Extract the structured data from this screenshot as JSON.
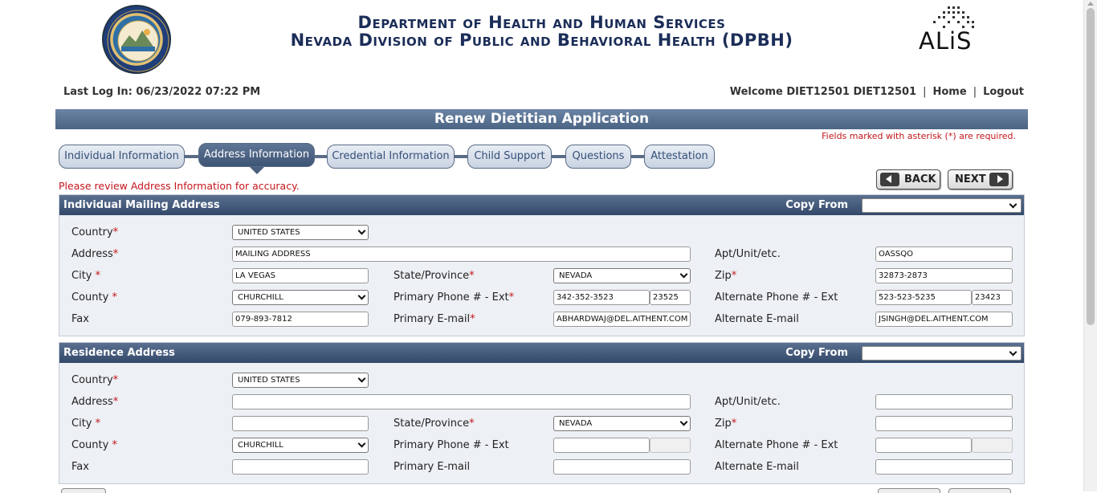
{
  "header": {
    "line1": "Department of Health and Human Services",
    "line2": "Nevada Division of Public and Behavioral Health (DPBH)",
    "seal_icon": "nevada-state-seal",
    "logo_text": "ALiS"
  },
  "user": {
    "last_login": "Last Log In: 06/23/2022 07:22 PM",
    "welcome": "Welcome DIET12501 DIET12501",
    "sep": "|",
    "home": "Home",
    "logout": "Logout"
  },
  "page": {
    "title": "Renew Dietitian Application",
    "required_note": "Fields marked with asterisk (*) are required.",
    "review_note": "Please review Address Information for accuracy."
  },
  "steps": [
    "Individual Information",
    "Address Information",
    "Credential Information",
    "Child Support",
    "Questions",
    "Attestation"
  ],
  "nav": {
    "back": "BACK",
    "next": "NEXT"
  },
  "asterisk": "*",
  "labels": {
    "country": "Country",
    "address": "Address",
    "city": "City",
    "county": "County",
    "fax": "Fax",
    "state": "State/Province",
    "primary_phone": "Primary Phone # - Ext",
    "primary_email": "Primary E-mail",
    "apt": "Apt/Unit/etc.",
    "zip": "Zip",
    "alt_phone": "Alternate Phone # - Ext",
    "alt_email": "Alternate E-mail",
    "copy_from": "Copy From"
  },
  "mailing": {
    "title": "Individual Mailing Address",
    "country": "UNITED STATES",
    "address": "MAILING ADDRESS",
    "city": "LA VEGAS",
    "county": "CHURCHILL",
    "fax": "079-893-7812",
    "state": "NEVADA",
    "primary_phone": "342-352-3523",
    "primary_ext": "23525",
    "primary_email": "ABHARDWAJ@DEL.AITHENT.COM",
    "apt": "OASSQO",
    "zip": "32873-2873",
    "alt_phone": "523-523-5235",
    "alt_ext": "23423",
    "alt_email": "JSINGH@DEL.AITHENT.COM"
  },
  "residence": {
    "title": "Residence Address",
    "country": "UNITED STATES",
    "address": "",
    "city": "",
    "county": "CHURCHILL",
    "fax": "",
    "state": "NEVADA",
    "primary_phone": "",
    "primary_ext": "",
    "primary_email": "",
    "apt": "",
    "zip": "",
    "alt_phone": "",
    "alt_ext": "",
    "alt_email": ""
  },
  "colors": {
    "brand_navy": "#1b2d58",
    "header_bar": "#4b6484",
    "required_red": "#c4161c"
  }
}
